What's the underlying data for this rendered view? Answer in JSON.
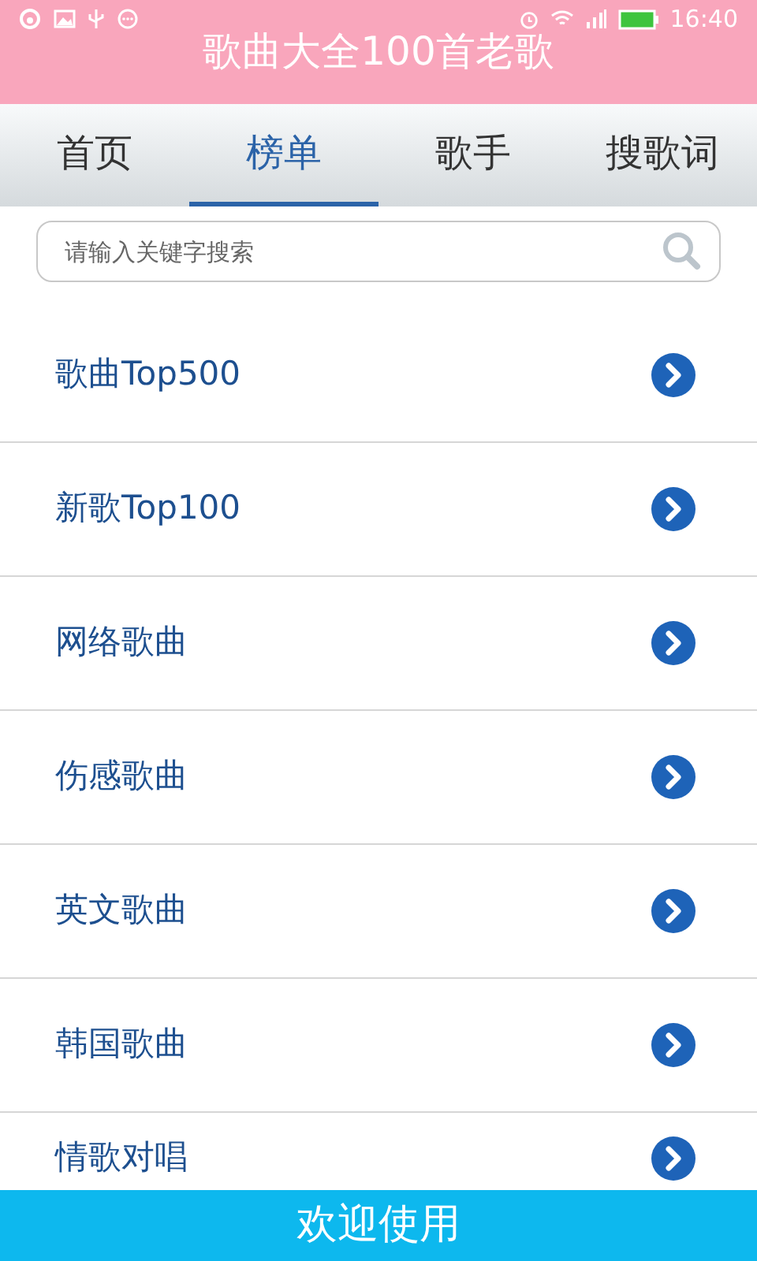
{
  "status_bar": {
    "time": "16:40"
  },
  "header": {
    "title": "歌曲大全100首老歌"
  },
  "tabs": [
    {
      "label": "首页",
      "selected": false
    },
    {
      "label": "榜单",
      "selected": true
    },
    {
      "label": "歌手",
      "selected": false
    },
    {
      "label": "搜歌词",
      "selected": false
    }
  ],
  "search": {
    "placeholder": "请输入关键字搜索"
  },
  "list": [
    {
      "label": "歌曲Top500"
    },
    {
      "label": "新歌Top100"
    },
    {
      "label": "网络歌曲"
    },
    {
      "label": "伤感歌曲"
    },
    {
      "label": "英文歌曲"
    },
    {
      "label": "韩国歌曲"
    },
    {
      "label": "情歌对唱"
    }
  ],
  "footer": {
    "text": "欢迎使用"
  }
}
